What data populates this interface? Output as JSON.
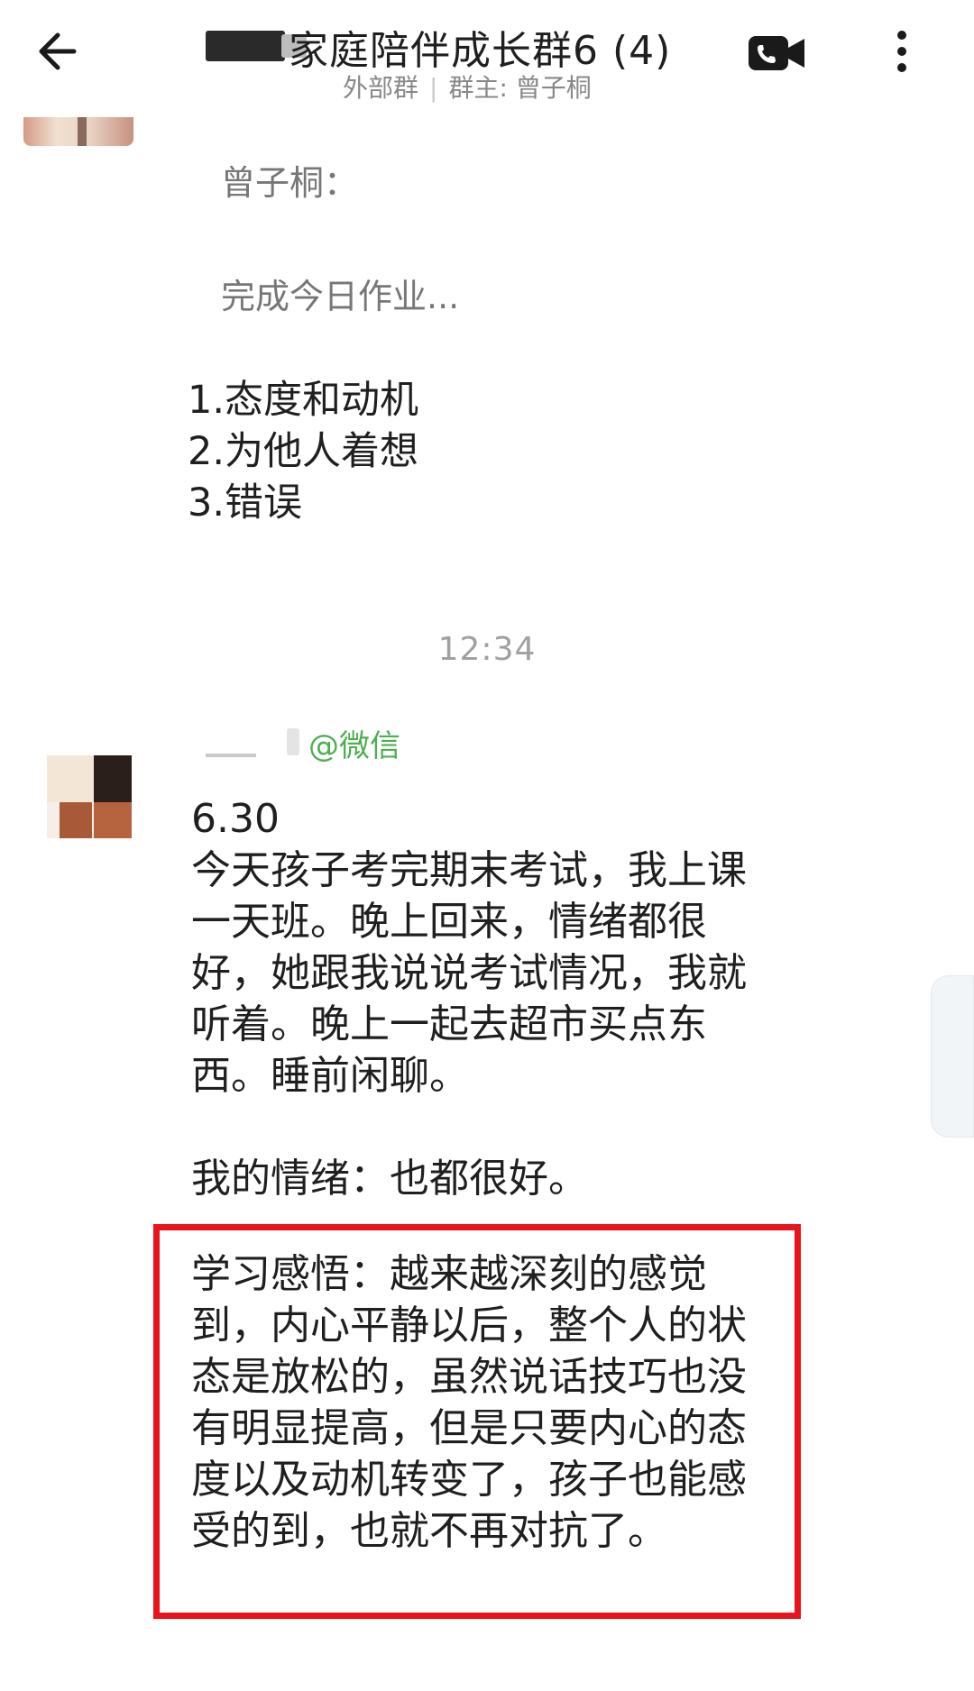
{
  "header": {
    "title": "家庭陪伴成长群6",
    "title_count": "(4)",
    "subtitle_left": "外部群",
    "subtitle_right": "群主: 曾子桐",
    "back_icon": "arrow-left-icon",
    "call_icon": "phone-video-icon",
    "more_icon": "more-vertical-icon"
  },
  "quoted_message": {
    "sender": "曾子桐：",
    "text": "完成今日作业..."
  },
  "topics": [
    "1.态度和动机",
    "2.为他人着想",
    "3.错误"
  ],
  "timestamp": "12:34",
  "message": {
    "sender_suffix": "@微信",
    "date": "6.30",
    "body": "今天孩子考完期末考试，我上课一天班。晚上回来，情绪都很好，她跟我说说考试情况，我就听着。晚上一起去超市买点东西。睡前闲聊。",
    "emotion": "我的情绪：也都很好。",
    "insight": "学习感悟：越来越深刻的感觉到，内心平静以后，整个人的状态是放松的，虽然说话技巧也没有明显提高，但是只要内心的态度以及动机转变了，孩子也能感受的到，也就不再对抗了。"
  },
  "colors": {
    "highlight_border": "#e8131b",
    "sender_tag": "#4caf50",
    "timestamp": "#a0a0a0",
    "subtitle": "#888888"
  }
}
